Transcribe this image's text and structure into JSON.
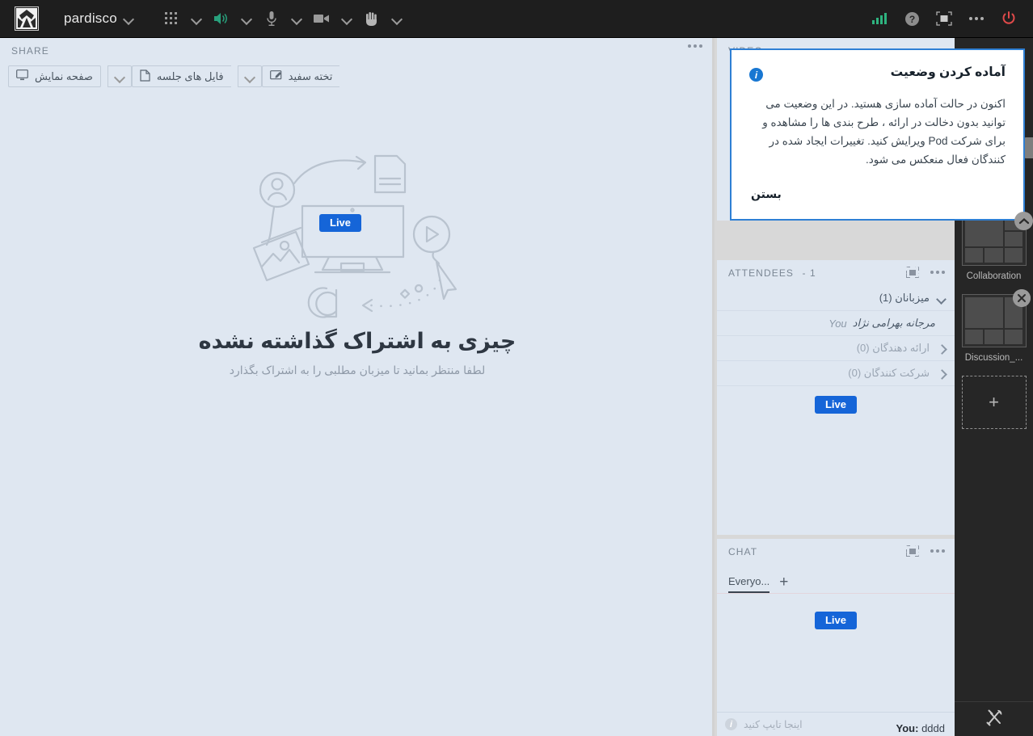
{
  "topbar": {
    "room_title": "pardisco",
    "logo_name": "adobe-connect-logo",
    "controls": [
      {
        "name": "apps-grid-icon",
        "label": ""
      },
      {
        "name": "speaker-icon",
        "label": ""
      },
      {
        "name": "microphone-icon",
        "label": ""
      },
      {
        "name": "camera-icon",
        "label": ""
      },
      {
        "name": "raise-hand-icon",
        "label": ""
      }
    ],
    "right_controls": [
      {
        "name": "connection-signal-icon"
      },
      {
        "name": "help-icon"
      },
      {
        "name": "fullscreen-icon"
      },
      {
        "name": "more-options-icon"
      },
      {
        "name": "end-meeting-power-icon"
      }
    ],
    "accent_green": "#28a07c",
    "accent_red": "#e04a4a"
  },
  "share": {
    "pod_title": "SHARE",
    "buttons": {
      "screen": "صفحه نمایش",
      "documents": "فایل های جلسه",
      "whiteboard": "تخته سفید"
    },
    "empty_title": "چیزی به اشتراک گذاشته نشده",
    "empty_subtitle": "لطفا منتظر بمانید تا میزبان مطلبی را به اشتراک بگذارد",
    "live_badge": "Live"
  },
  "video": {
    "pod_title": "VIDEO"
  },
  "attendees": {
    "pod_title": "ATTENDEES",
    "count_label": "- 1",
    "live_badge": "Live",
    "groups": [
      {
        "label": "میزبانان (1)",
        "expanded": true
      },
      {
        "label": "ارائه دهندگان (0)",
        "expanded": false
      },
      {
        "label": "شرکت کنندگان (0)",
        "expanded": false
      }
    ],
    "host_name": "مرجانه بهرامی نژاد",
    "host_you": "You"
  },
  "chat": {
    "pod_title": "CHAT",
    "tab_label": "Everyo...",
    "add_tab": "+",
    "live_badge": "Live",
    "message_sender": "You:",
    "message_text": "dddd",
    "input_placeholder": "اینجا تایپ کنید"
  },
  "layouts": {
    "items": [
      {
        "label": "Collaboration",
        "closable": false
      },
      {
        "label": "Discussion_...",
        "closable": true
      }
    ],
    "add_label": "+",
    "tools_icon": "tools-icon"
  },
  "dialog": {
    "title": "آماده کردن وضعیت",
    "body": "اکنون در حالت آماده سازی هستید. در این وضعیت می توانید بدون دخالت در ارائه ، طرح بندی ها را مشاهده و برای شرکت Pod ویرایش کنید. تغییرات ایجاد شده در کنندگان فعال منعکس می شود.",
    "close_label": "بستن",
    "border_color": "#2e7fd4",
    "info_color": "#1877d2"
  },
  "colors": {
    "pod_bg": "#dfe7f1",
    "chrome_dark": "#1e1e1e",
    "rail_dark": "#262626",
    "live_blue": "#1565d8"
  }
}
